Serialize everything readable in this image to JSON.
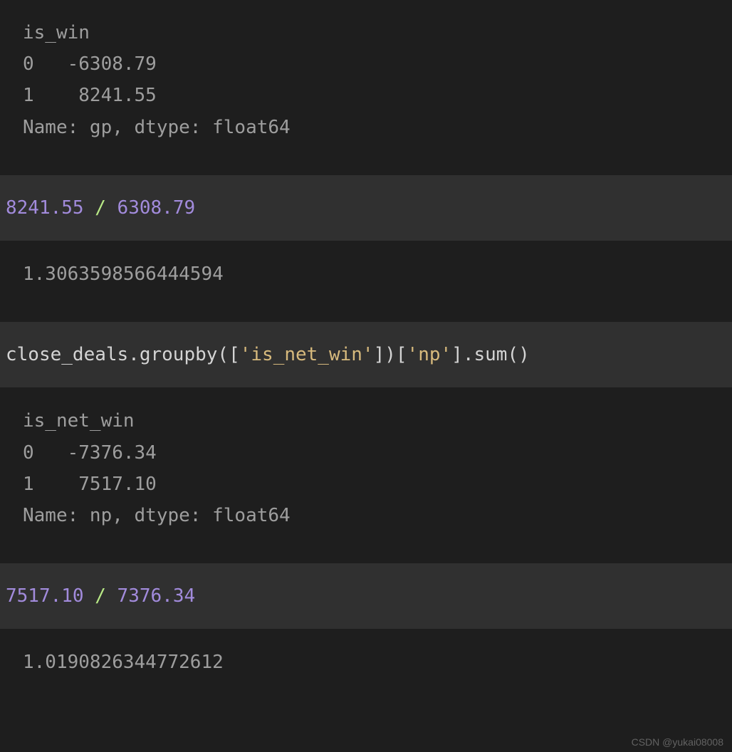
{
  "cells": {
    "out1": {
      "line1": "is_win",
      "line2": "0   -6308.79",
      "line3": "1    8241.55",
      "line4": "Name: gp, dtype: float64"
    },
    "in2": {
      "a": "8241.55",
      "op": " / ",
      "b": "6308.79"
    },
    "out2": {
      "line1": "1.3063598566444594"
    },
    "in3": {
      "t1": "close_deals.groupby([",
      "s1": "'is_net_win'",
      "t2": "])[",
      "s2": "'np'",
      "t3": "].sum()"
    },
    "out3": {
      "line1": "is_net_win",
      "line2": "0   -7376.34",
      "line3": "1    7517.10",
      "line4": "Name: np, dtype: float64"
    },
    "in4": {
      "a": "7517.10",
      "op": " / ",
      "b": "7376.34"
    },
    "out4": {
      "line1": "1.0190826344772612"
    }
  },
  "watermark": "CSDN @yukai08008"
}
